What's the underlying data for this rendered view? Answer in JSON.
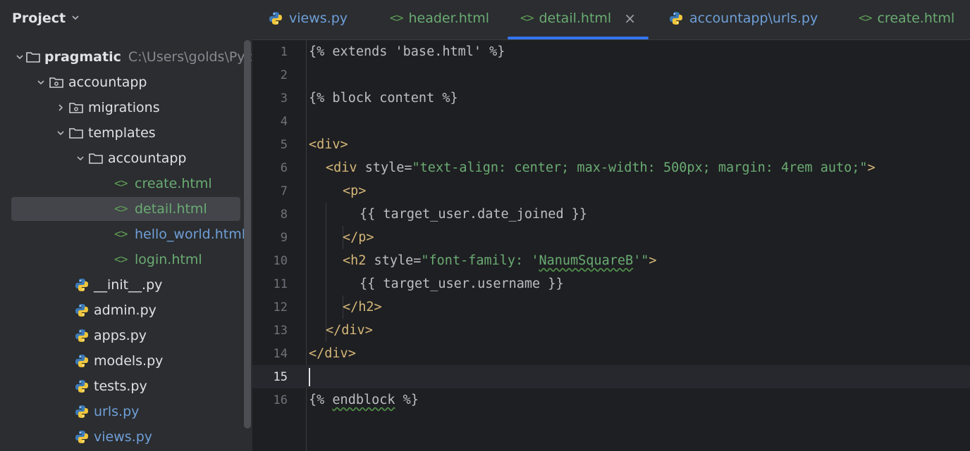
{
  "project_panel": {
    "title": "Project",
    "tree": [
      {
        "label": "pragmatic",
        "path": "C:\\Users\\golds\\Pyc",
        "kind": "folder"
      },
      {
        "label": "accountapp",
        "kind": "module-folder"
      },
      {
        "label": "migrations",
        "kind": "module-folder"
      },
      {
        "label": "templates",
        "kind": "folder"
      },
      {
        "label": "accountapp",
        "kind": "folder"
      },
      {
        "label": "create.html",
        "kind": "html"
      },
      {
        "label": "detail.html",
        "kind": "html"
      },
      {
        "label": "hello_world.html",
        "kind": "html"
      },
      {
        "label": "login.html",
        "kind": "html"
      },
      {
        "label": "__init__.py",
        "kind": "python"
      },
      {
        "label": "admin.py",
        "kind": "python"
      },
      {
        "label": "apps.py",
        "kind": "python"
      },
      {
        "label": "models.py",
        "kind": "python"
      },
      {
        "label": "tests.py",
        "kind": "python"
      },
      {
        "label": "urls.py",
        "kind": "python"
      },
      {
        "label": "views.py",
        "kind": "python"
      }
    ]
  },
  "tabs": [
    {
      "label": "views.py",
      "kind": "python"
    },
    {
      "label": "header.html",
      "kind": "html"
    },
    {
      "label": "detail.html",
      "kind": "html",
      "active": true
    },
    {
      "label": "accountapp\\urls.py",
      "kind": "python"
    },
    {
      "label": "create.html",
      "kind": "html"
    }
  ],
  "editor": {
    "current_line": 15,
    "line_numbers": [
      "1",
      "2",
      "3",
      "4",
      "5",
      "6",
      "7",
      "8",
      "9",
      "10",
      "11",
      "12",
      "13",
      "14",
      "15",
      "16"
    ],
    "lines": {
      "l1": "{% extends 'base.html' %}",
      "l3": "{% block content %}",
      "l5_tag": "<div>",
      "l6_open": "<div",
      "l6_attr": " style=",
      "l6_val": "\"text-align: center; max-width: 500px; margin: 4rem auto;\"",
      "l6_close": ">",
      "l7": "<p>",
      "l8": "{{ target_user.date_joined }}",
      "l9": "</p>",
      "l10_open": "<h2",
      "l10_attr": " style=",
      "l10_val_a": "\"font-family: '",
      "l10_val_b": "NanumSquareB",
      "l10_val_c": "'\"",
      "l10_close": ">",
      "l11": "{{ target_user.username }}",
      "l12": "</h2>",
      "l13": "</div>",
      "l14": "</div>",
      "l16_a": "{% ",
      "l16_b": "endblock",
      "l16_c": " %}"
    }
  },
  "colors": {
    "accent": "#3574f0",
    "html_file": "#6aab73",
    "python_file": "#6f9fd8",
    "tag": "#d5b778",
    "string": "#6aab73"
  }
}
